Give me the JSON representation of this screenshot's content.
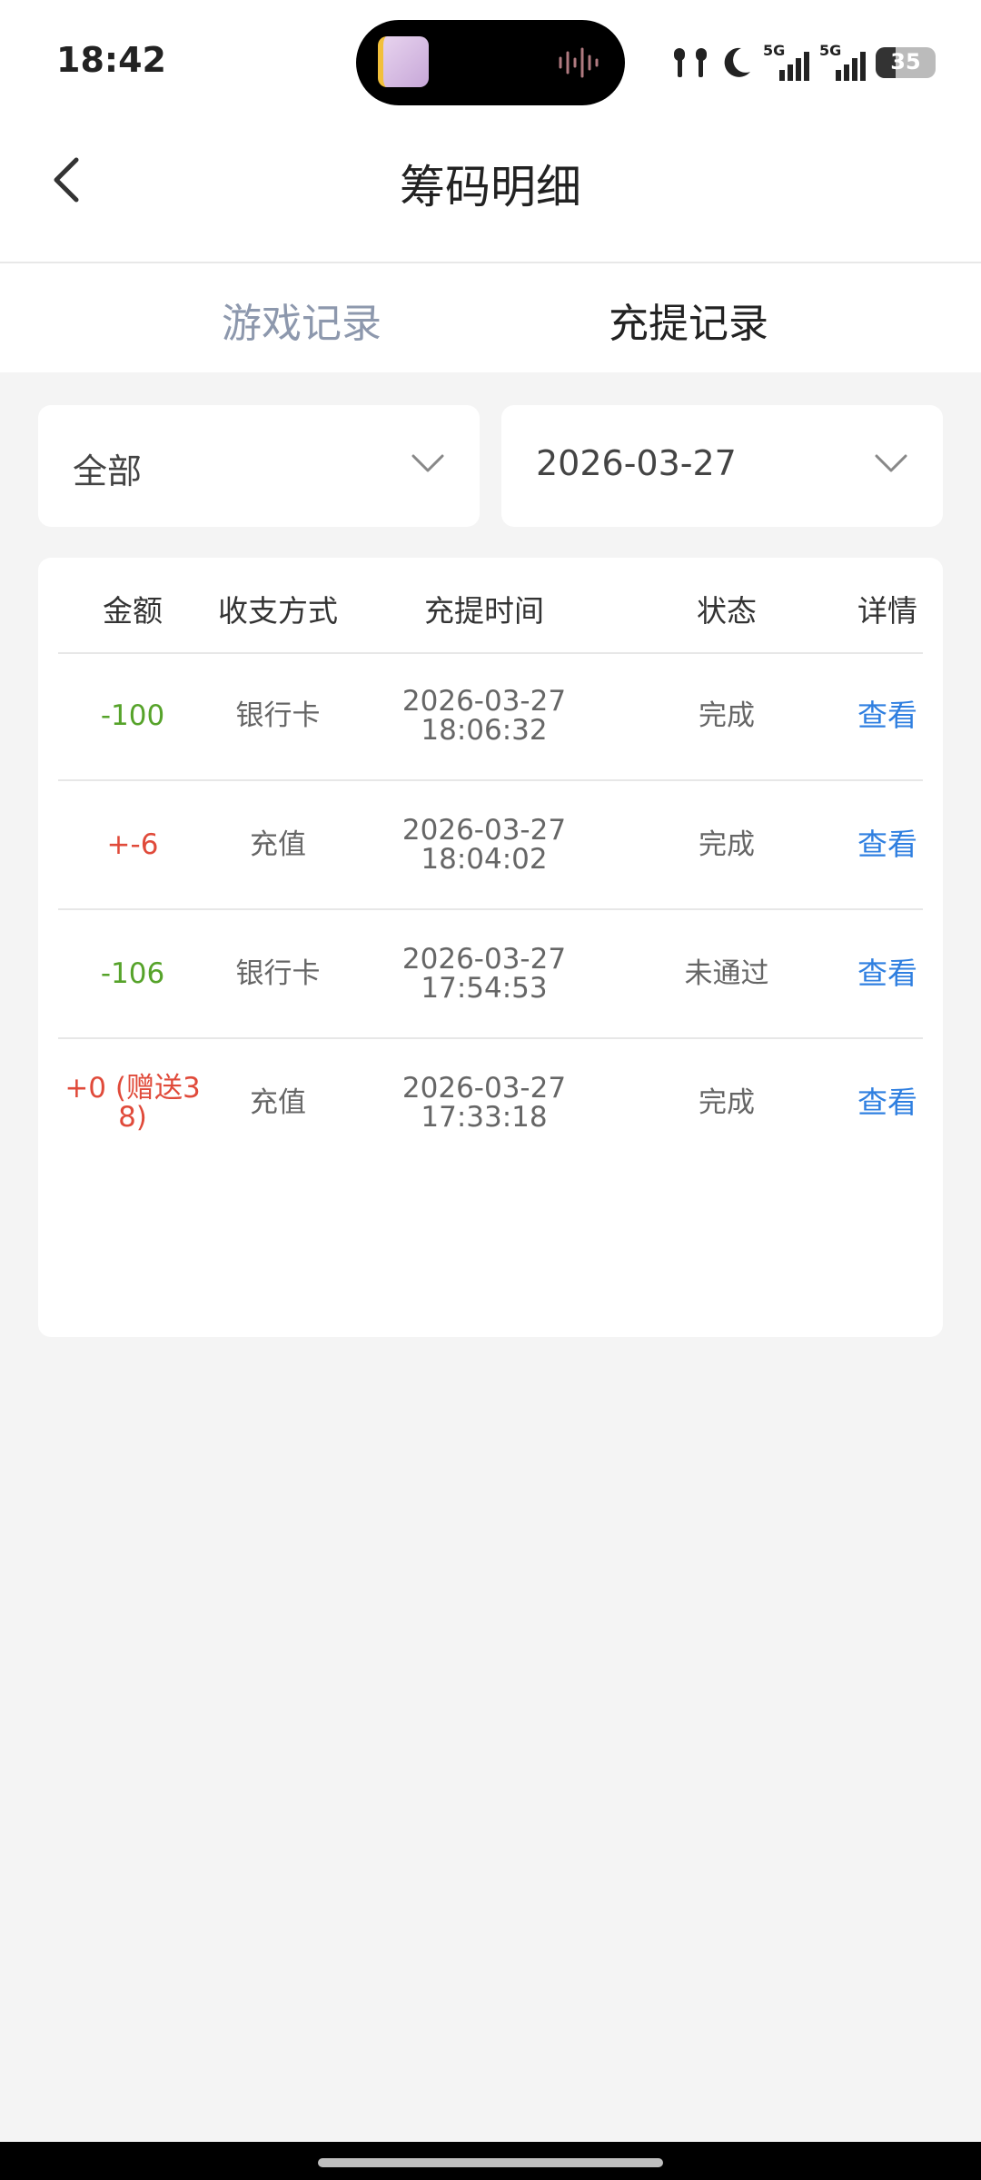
{
  "status_bar": {
    "time": "18:42",
    "network_labels": [
      "5G",
      "5G"
    ],
    "battery": "35"
  },
  "header": {
    "title": "筹码明细"
  },
  "tabs": [
    {
      "label": "游戏记录",
      "active": false
    },
    {
      "label": "充提记录",
      "active": true
    }
  ],
  "filters": {
    "type_select": {
      "value": "全部"
    },
    "date_select": {
      "value": "2026-03-27"
    }
  },
  "table": {
    "columns": [
      "金额",
      "收支方式",
      "充提时间",
      "状态",
      "详情"
    ],
    "rows": [
      {
        "amount": "-100",
        "method": "银行卡",
        "date": "2026-03-27",
        "time": "18:06:32",
        "status": "完成",
        "detail": "查看"
      },
      {
        "amount": "+-6",
        "method": "充值",
        "date": "2026-03-27",
        "time": "18:04:02",
        "status": "完成",
        "detail": "查看"
      },
      {
        "amount": "-106",
        "method": "银行卡",
        "date": "2026-03-27",
        "time": "17:54:53",
        "status": "未通过",
        "detail": "查看"
      },
      {
        "amount": "+0 (赠送38)",
        "amount_line1": "+0 (赠送3",
        "amount_line2": "8)",
        "method": "充值",
        "date": "2026-03-27",
        "time": "17:33:18",
        "status": "完成",
        "detail": "查看"
      }
    ]
  },
  "colors": {
    "negative_amount": "#56a32a",
    "positive_amount": "#e04a3a",
    "link": "#2f7fe0",
    "inactive_tab": "#8d98ad"
  }
}
